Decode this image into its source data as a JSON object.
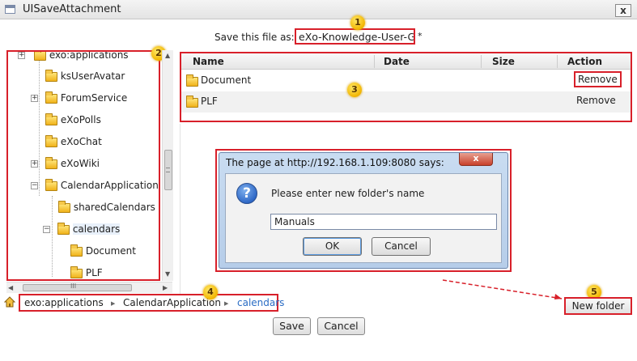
{
  "window": {
    "title": "UISaveAttachment",
    "close_label": "x"
  },
  "save": {
    "label": "Save this file as:",
    "value": "eXo-Knowledge-User-Gui",
    "required_mark": "*"
  },
  "markers": [
    "1",
    "2",
    "3",
    "4",
    "5"
  ],
  "tree": {
    "items": [
      {
        "label": "exo:applications",
        "expandable": true
      },
      {
        "label": "ksUserAvatar",
        "expandable": false
      },
      {
        "label": "ForumService",
        "expandable": true
      },
      {
        "label": "eXoPolls",
        "expandable": false
      },
      {
        "label": "eXoChat",
        "expandable": false
      },
      {
        "label": "eXoWiki",
        "expandable": true
      },
      {
        "label": "CalendarApplication",
        "expandable": true
      },
      {
        "label": "sharedCalendars",
        "expandable": false
      },
      {
        "label": "calendars",
        "expandable": true,
        "selected": true
      },
      {
        "label": "Document",
        "expandable": false
      },
      {
        "label": "PLF",
        "expandable": false
      }
    ],
    "scroll_grip": "≡",
    "hscroll_grip": "III"
  },
  "table": {
    "columns": [
      "Name",
      "Date",
      "Size",
      "Action"
    ],
    "rows": [
      {
        "name": "Document",
        "date": "",
        "size": "",
        "action": "Remove"
      },
      {
        "name": "PLF",
        "date": "",
        "size": "",
        "action": "Remove"
      }
    ]
  },
  "dialog": {
    "title": "The page at http://192.168.1.109:8080 says:",
    "close_label": "x",
    "icon_glyph": "?",
    "message": "Please enter new folder's name",
    "input_value": "Manuals",
    "ok_label": "OK",
    "cancel_label": "Cancel"
  },
  "new_folder": {
    "label": "New folder"
  },
  "breadcrumb": {
    "items": [
      "exo:applications",
      "CalendarApplication",
      "calendars"
    ]
  },
  "footer": {
    "save_label": "Save",
    "cancel_label": "Cancel"
  },
  "colors": {
    "highlight": "#d8202a",
    "link": "#2a6cc4",
    "marker": "#f2b500"
  }
}
